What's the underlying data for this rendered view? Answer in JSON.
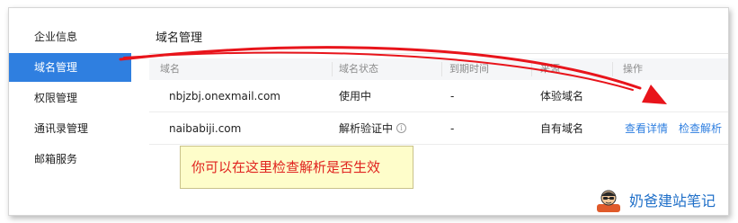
{
  "sidebar": {
    "items": [
      {
        "label": "企业信息",
        "active": false
      },
      {
        "label": "域名管理",
        "active": true
      },
      {
        "label": "权限管理",
        "active": false
      },
      {
        "label": "通讯录管理",
        "active": false
      },
      {
        "label": "邮箱服务",
        "active": false
      }
    ]
  },
  "main": {
    "title": "域名管理",
    "table": {
      "columns": [
        "域名",
        "域名状态",
        "到期时间",
        "来源",
        "操作"
      ],
      "rows": [
        {
          "domain": "nbjzbj.onexmail.com",
          "status": "使用中",
          "expiry": "-",
          "source": "体验域名",
          "actions": []
        },
        {
          "domain": "naibabiji.com",
          "status": "解析验证中",
          "status_icon": "info-icon",
          "expiry": "-",
          "source": "自有域名",
          "actions": [
            "查看详情",
            "检查解析"
          ]
        }
      ]
    }
  },
  "annotation": {
    "note": "你可以在这里检查解析是否生效",
    "arrow_color": "#e8141b"
  },
  "watermark": {
    "text": "奶爸建站笔记"
  },
  "colors": {
    "accent": "#2f7fe0",
    "note_bg": "#fefdca",
    "note_text": "#e0231f"
  }
}
